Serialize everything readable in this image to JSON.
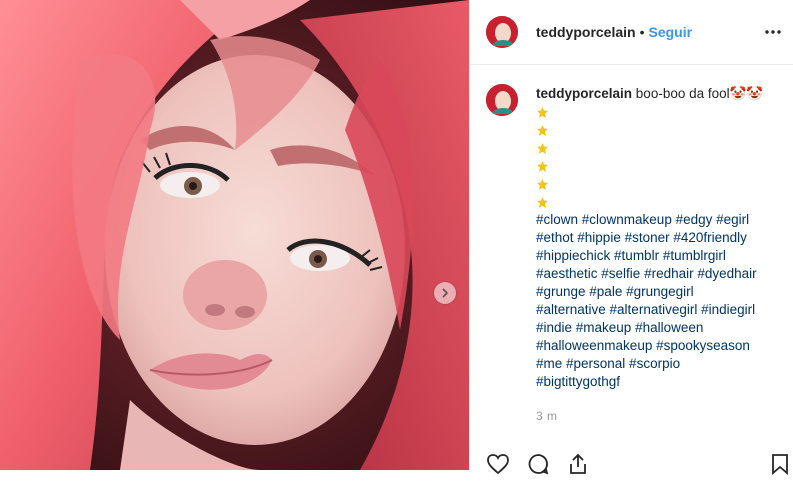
{
  "post": {
    "username": "teddyporcelain",
    "separator": "•",
    "follow_label": "Seguir",
    "caption_text": "boo-boo da fool🤡🤡",
    "hashtag_lines": [
      "#clown #clownmakeup #edgy #egirl",
      "#ethot #hippie #stoner #420friendly",
      "#hippiechick #tumblr #tumblrgirl",
      "#aesthetic #selfie #redhair #dyedhair",
      "#grunge #pale #grungegirl",
      "#alternative #alternativegirl #indiegirl",
      "#indie #makeup #halloween",
      "#halloweenmakeup #spookyseason",
      "#me #personal #scorpio",
      "#bigtittygothgf"
    ],
    "emoji_lines": 6,
    "time_ago": "3 m"
  },
  "colors": {
    "link_blue": "#3897f0",
    "hashtag": "#003569",
    "emoji_gold": "#f3c318"
  },
  "icons": {
    "more": "more-options-icon",
    "next": "chevron-right-icon",
    "like": "heart-icon",
    "comment": "comment-icon",
    "share": "share-icon",
    "save": "bookmark-icon"
  }
}
